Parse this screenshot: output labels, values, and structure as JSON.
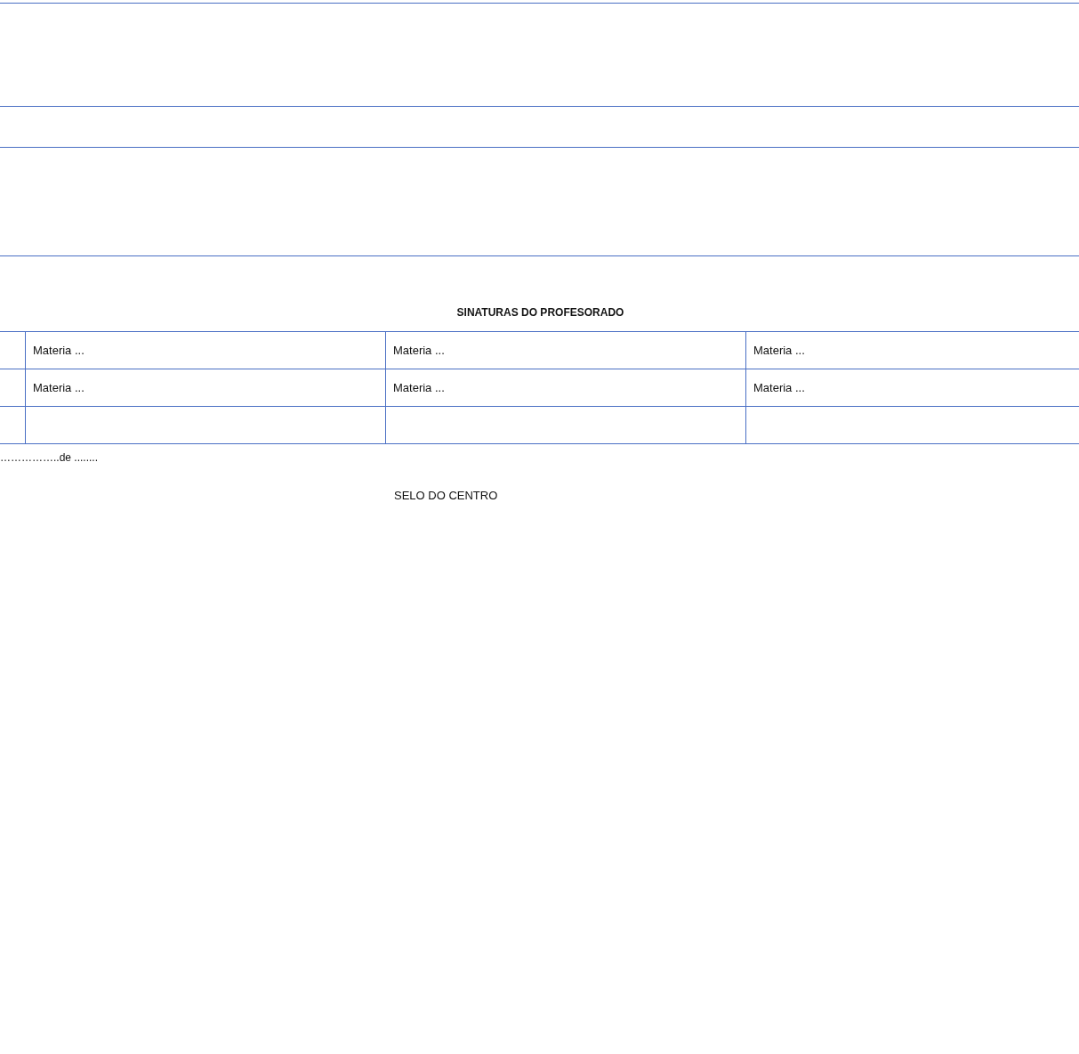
{
  "heading": "SINATURAS DO PROFESORADO",
  "signature_table": {
    "rows": [
      [
        "",
        "Materia ...",
        "Materia ...",
        "Materia ..."
      ],
      [
        "",
        "Materia ...",
        "Materia ...",
        "Materia ..."
      ],
      [
        "",
        "",
        "",
        ""
      ]
    ]
  },
  "date_line": "……………..de ........",
  "stamp_label": "SELO DO CENTRO"
}
